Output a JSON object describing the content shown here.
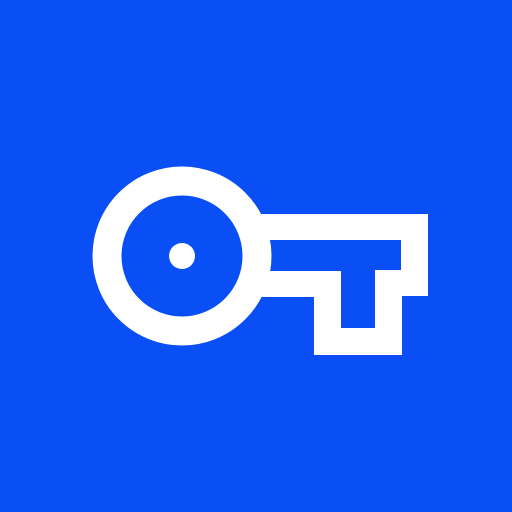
{
  "app_icon": {
    "icon": "key-icon",
    "background_color": "#0a4ef5",
    "foreground_color": "#ffffff"
  }
}
